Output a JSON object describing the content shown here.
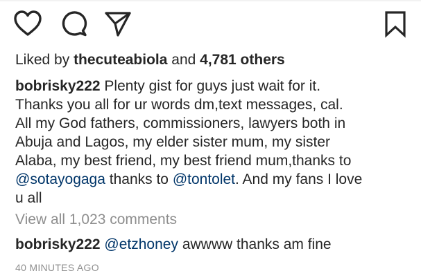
{
  "actions": {
    "like_icon": "heart-outline-icon",
    "comment_icon": "speech-bubble-icon",
    "share_icon": "paper-plane-icon",
    "save_icon": "bookmark-outline-icon"
  },
  "likes": {
    "prefix": "Liked by ",
    "user": "thecuteabiola",
    "middle": " and ",
    "count": "4,781 others"
  },
  "caption": {
    "username": "bobrisky222",
    "line1_text": " Plenty gist for guys just wait for it.",
    "line2": "Thanks you all for ur words dm,text messages, cal.",
    "line3": "All my God fathers, commissioners, lawyers both in",
    "line4": "Abuja and Lagos, my elder sister mum, my sister",
    "line5": "Alaba, my best friend, my best friend mum,thanks to",
    "mention1": "@sotayogaga",
    "line6_mid": " thanks to ",
    "mention2": "@tontolet",
    "line6_end": ". And my fans I love",
    "line7": "u all"
  },
  "comments": {
    "view_all": "View all 1,023 comments",
    "items": [
      {
        "username": "bobrisky222",
        "mention": "@etzhoney",
        "text": " awwww thanks am fine"
      }
    ]
  },
  "timestamp": "40 MINUTES AGO",
  "colors": {
    "text": "#262626",
    "muted": "#8e8e8e",
    "mention": "#003569"
  }
}
